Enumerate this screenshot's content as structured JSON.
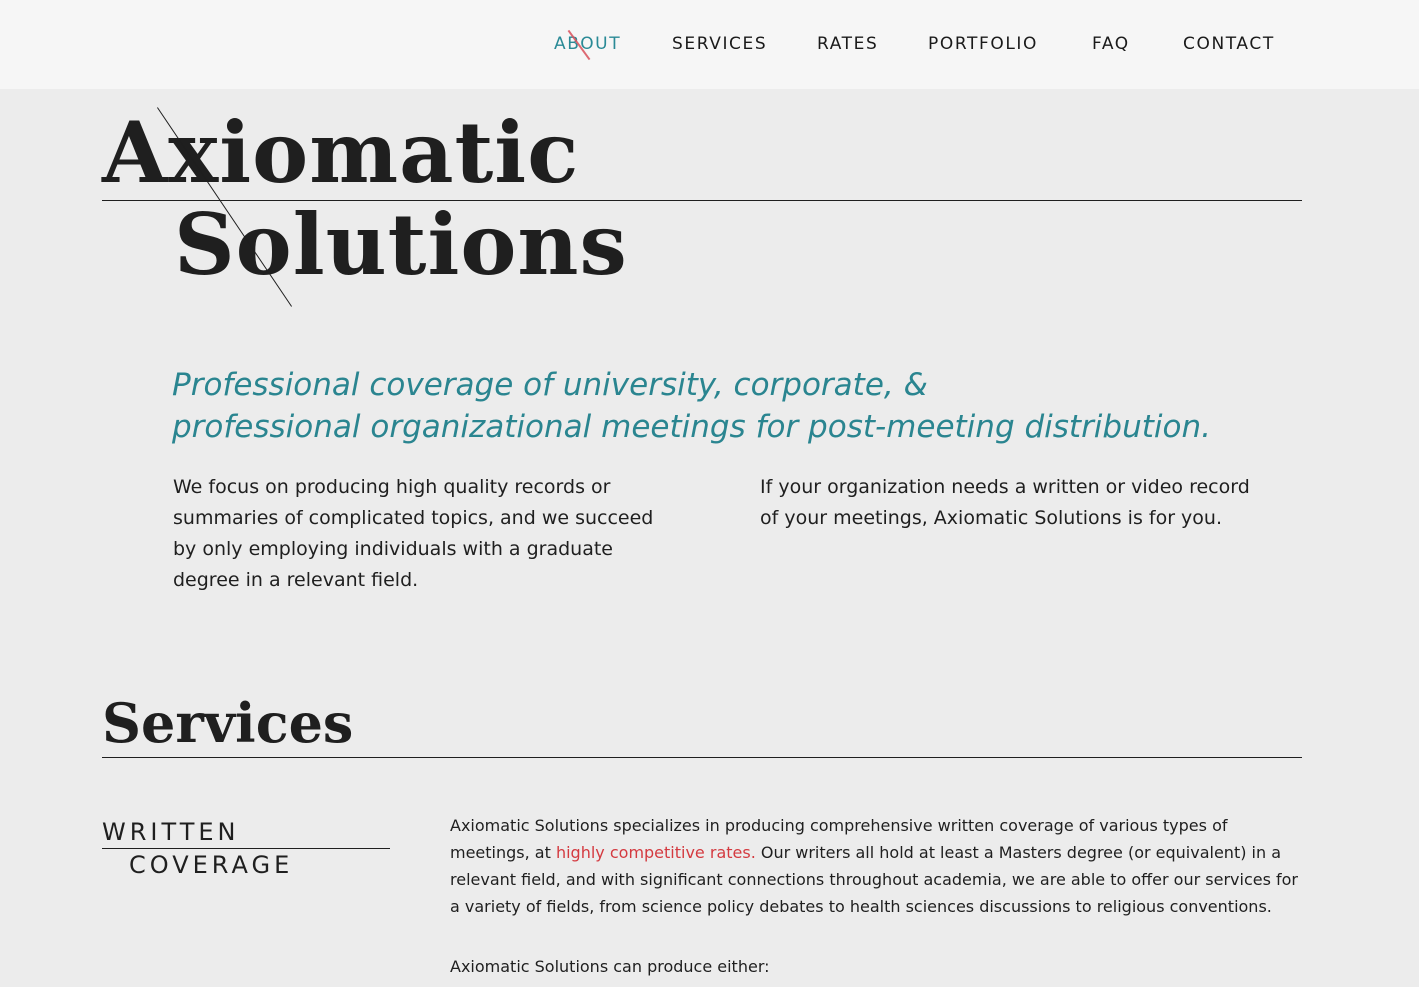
{
  "nav": {
    "items": [
      {
        "label": "ABOUT",
        "active": true
      },
      {
        "label": "SERVICES",
        "active": false
      },
      {
        "label": "RATES",
        "active": false
      },
      {
        "label": "PORTFOLIO",
        "active": false
      },
      {
        "label": "FAQ",
        "active": false
      },
      {
        "label": "CONTACT",
        "active": false
      }
    ]
  },
  "logo": {
    "line1": "Axiomatic",
    "line2": "Solutions"
  },
  "hero": {
    "tagline_line1": "Professional coverage of university, corporate, &",
    "tagline_line2": "professional organizational meetings for post-meeting distribution.",
    "left_paragraph": "We focus on producing high quality records or summaries of complicated topics, and we succeed by only employing individuals with a graduate degree in a relevant field.",
    "right_paragraph": "If your organization needs a written or video record of your meetings, Axiomatic Solutions is for you."
  },
  "services": {
    "title": "Services",
    "written": {
      "title_line1": "WRITTEN",
      "title_line2": "COVERAGE",
      "text_before_link": "Axiomatic Solutions specializes in producing comprehensive written coverage of various types of meetings, at ",
      "link_text": "highly competitive rates.",
      "text_after_link": " Our writers all hold at least a Masters degree (or equivalent) in a relevant field, and with significant connections throughout academia, we are able to offer our services for a variety of fields, from science policy debates to health sciences discussions to religious conventions.",
      "produce_intro": "Axiomatic Solutions can produce either:"
    }
  },
  "colors": {
    "accent_teal": "#2a8590",
    "link_red": "#d43a40",
    "background": "#ececec",
    "header_bg": "#f6f6f6"
  }
}
